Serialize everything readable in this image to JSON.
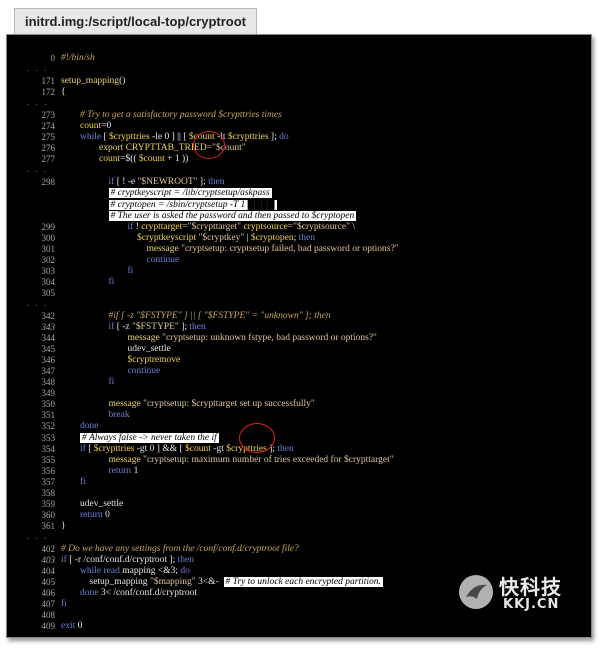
{
  "tab": {
    "title": "initrd.img:/script/local-top/cryptroot"
  },
  "watermark": {
    "cn": "快科技",
    "domain": "KKJ.CN"
  },
  "lines": [
    {
      "n": "0",
      "segs": [
        [
          "cmt",
          "#!/bin/sh"
        ]
      ]
    },
    {
      "sep": true
    },
    {
      "n": "171",
      "segs": [
        [
          "fn",
          "setup_mapping"
        ],
        [
          "plain",
          "()"
        ]
      ]
    },
    {
      "n": "172",
      "segs": [
        [
          "plain",
          "{"
        ]
      ]
    },
    {
      "sep": true
    },
    {
      "n": "273",
      "segs": [
        [
          "plain",
          "        "
        ],
        [
          "cmt",
          "# Try to get a satisfactory password $crypttries times"
        ]
      ]
    },
    {
      "n": "274",
      "segs": [
        [
          "plain",
          "        "
        ],
        [
          "var",
          "count"
        ],
        [
          "plain",
          "=0"
        ]
      ]
    },
    {
      "n": "275",
      "segs": [
        [
          "plain",
          "        "
        ],
        [
          "kw",
          "while"
        ],
        [
          "plain",
          " [ "
        ],
        [
          "var",
          "$crypttries"
        ],
        [
          "plain",
          " -le 0 ] || [ "
        ],
        [
          "var",
          "$count"
        ],
        [
          "plain",
          " -lt "
        ],
        [
          "var",
          "$crypttries"
        ],
        [
          "plain",
          " ]; "
        ],
        [
          "kw",
          "do"
        ]
      ]
    },
    {
      "n": "276",
      "segs": [
        [
          "plain",
          "                "
        ],
        [
          "fn",
          "export"
        ],
        [
          "plain",
          " "
        ],
        [
          "var",
          "CRYPTTAB_TRIED"
        ],
        [
          "str",
          "=\"$count\""
        ]
      ]
    },
    {
      "n": "277",
      "segs": [
        [
          "plain",
          "                "
        ],
        [
          "var",
          "count"
        ],
        [
          "plain",
          "=$(( "
        ],
        [
          "var",
          "$count"
        ],
        [
          "plain",
          " + 1 ))"
        ]
      ]
    },
    {
      "sep": true
    },
    {
      "n": "298",
      "segs": [
        [
          "plain",
          "                    "
        ],
        [
          "kw",
          "if"
        ],
        [
          "plain",
          " [ ! -e "
        ],
        [
          "str",
          "\"$NEWROOT\""
        ],
        [
          "plain",
          " ]; "
        ],
        [
          "kw",
          "then"
        ]
      ]
    },
    {
      "n": "",
      "segs": [
        [
          "plain",
          "                    "
        ],
        [
          "hl",
          "# cryptkeyscript = /lib/cryptsetup/askpass"
        ]
      ]
    },
    {
      "n": "",
      "segs": [
        [
          "plain",
          "                    "
        ],
        [
          "hl",
          "# cryptopen = /sbin/cryptsetup -T 1 ████"
        ]
      ]
    },
    {
      "n": "",
      "segs": [
        [
          "plain",
          "                    "
        ],
        [
          "hl",
          "# The user is asked the password and then passed to $cryptopen"
        ]
      ]
    },
    {
      "n": "299",
      "segs": [
        [
          "plain",
          "                            "
        ],
        [
          "kw",
          "if"
        ],
        [
          "plain",
          " ! "
        ],
        [
          "var",
          "crypttarget"
        ],
        [
          "str",
          "=\"$crypttarget\""
        ],
        [
          "plain",
          " "
        ],
        [
          "var",
          "cryptsource"
        ],
        [
          "str",
          "=\"$cryptsource\""
        ],
        [
          "plain",
          " \\"
        ]
      ]
    },
    {
      "n": "300",
      "segs": [
        [
          "plain",
          "                                "
        ],
        [
          "var",
          "$cryptkeyscript"
        ],
        [
          "plain",
          " "
        ],
        [
          "str",
          "\"$cryptkey\""
        ],
        [
          "plain",
          " | "
        ],
        [
          "var",
          "$cryptopen"
        ],
        [
          "plain",
          "; "
        ],
        [
          "kw",
          "then"
        ]
      ]
    },
    {
      "n": "301",
      "segs": [
        [
          "plain",
          "                                    "
        ],
        [
          "fn",
          "message"
        ],
        [
          "plain",
          " "
        ],
        [
          "str",
          "\"cryptsetup: cryptsetup failed, bad password or options?\""
        ]
      ]
    },
    {
      "n": "302",
      "segs": [
        [
          "plain",
          "                                    "
        ],
        [
          "kw",
          "continue"
        ]
      ]
    },
    {
      "n": "303",
      "segs": [
        [
          "plain",
          "                            "
        ],
        [
          "kw",
          "fi"
        ]
      ]
    },
    {
      "n": "304",
      "segs": [
        [
          "plain",
          "                    "
        ],
        [
          "kw",
          "fi"
        ]
      ]
    },
    {
      "n": "305",
      "segs": []
    },
    {
      "sep": true
    },
    {
      "n": "342",
      "segs": [
        [
          "plain",
          "                    "
        ],
        [
          "cmt",
          "#if [ -z \"$FSTYPE\" ] || [ \"$FSTYPE\" = \"unknown\" ]; then"
        ]
      ]
    },
    {
      "n": "343",
      "it": true,
      "segs": [
        [
          "plain",
          "                    "
        ],
        [
          "kw",
          "if"
        ],
        [
          "plain",
          " [ -z "
        ],
        [
          "str",
          "\"$FSTYPE\""
        ],
        [
          "plain",
          " ]; "
        ],
        [
          "kw",
          "then"
        ]
      ]
    },
    {
      "n": "344",
      "segs": [
        [
          "plain",
          "                            "
        ],
        [
          "fn",
          "message"
        ],
        [
          "plain",
          " "
        ],
        [
          "str",
          "\"cryptsetup: unknown fstype, bad password or options?\""
        ]
      ]
    },
    {
      "n": "345",
      "segs": [
        [
          "plain",
          "                            "
        ],
        [
          "plain",
          "udev_settle"
        ]
      ]
    },
    {
      "n": "346",
      "segs": [
        [
          "plain",
          "                            "
        ],
        [
          "var",
          "$cryptremove"
        ]
      ]
    },
    {
      "n": "347",
      "segs": [
        [
          "plain",
          "                            "
        ],
        [
          "kw",
          "continue"
        ]
      ]
    },
    {
      "n": "348",
      "segs": [
        [
          "plain",
          "                    "
        ],
        [
          "kw",
          "fi"
        ]
      ]
    },
    {
      "n": "349",
      "segs": []
    },
    {
      "n": "350",
      "segs": [
        [
          "plain",
          "                    "
        ],
        [
          "fn",
          "message"
        ],
        [
          "plain",
          " "
        ],
        [
          "str",
          "\"cryptsetup: $crypttarget set up successfully\""
        ]
      ]
    },
    {
      "n": "351",
      "segs": [
        [
          "plain",
          "                    "
        ],
        [
          "kw",
          "break"
        ]
      ]
    },
    {
      "n": "352",
      "segs": [
        [
          "plain",
          "        "
        ],
        [
          "kw",
          "done"
        ]
      ]
    },
    {
      "n": "353",
      "segs": [
        [
          "plain",
          "        "
        ],
        [
          "hl",
          "# Always false -> never taken the if"
        ]
      ]
    },
    {
      "n": "354",
      "segs": [
        [
          "plain",
          "        "
        ],
        [
          "kw",
          "if"
        ],
        [
          "plain",
          " [ "
        ],
        [
          "var",
          "$crypttries"
        ],
        [
          "plain",
          " -gt 0 ] && [ "
        ],
        [
          "var",
          "$count"
        ],
        [
          "plain",
          " -gt "
        ],
        [
          "var",
          "$crypttries"
        ],
        [
          "plain",
          " ]; "
        ],
        [
          "kw",
          "then"
        ]
      ]
    },
    {
      "n": "355",
      "segs": [
        [
          "plain",
          "                    "
        ],
        [
          "fn",
          "message"
        ],
        [
          "plain",
          " "
        ],
        [
          "str",
          "\"cryptsetup: maximum number of tries exceeded for $crypttarget\""
        ]
      ]
    },
    {
      "n": "356",
      "segs": [
        [
          "plain",
          "                    "
        ],
        [
          "kw",
          "return"
        ],
        [
          "plain",
          " 1"
        ]
      ]
    },
    {
      "n": "357",
      "segs": [
        [
          "plain",
          "        "
        ],
        [
          "kw",
          "fi"
        ]
      ]
    },
    {
      "n": "358",
      "segs": []
    },
    {
      "n": "359",
      "segs": [
        [
          "plain",
          "        "
        ],
        [
          "plain",
          "udev_settle"
        ]
      ]
    },
    {
      "n": "360",
      "segs": [
        [
          "plain",
          "        "
        ],
        [
          "kw",
          "return"
        ],
        [
          "plain",
          " 0"
        ]
      ]
    },
    {
      "n": "361",
      "segs": [
        [
          "plain",
          "}"
        ]
      ]
    },
    {
      "sep": true
    },
    {
      "n": "402",
      "segs": [
        [
          "cmt",
          "# Do we have any settings from the /conf/conf.d/cryptroot file?"
        ]
      ]
    },
    {
      "n": "403",
      "it": true,
      "segs": [
        [
          "kw",
          "if"
        ],
        [
          "plain",
          " [ -r /conf/conf.d/cryptroot ]; "
        ],
        [
          "kw",
          "then"
        ]
      ]
    },
    {
      "n": "404",
      "segs": [
        [
          "plain",
          "        "
        ],
        [
          "kw",
          "while"
        ],
        [
          "plain",
          " "
        ],
        [
          "kw",
          "read"
        ],
        [
          "plain",
          " mapping <&3; "
        ],
        [
          "kw",
          "do"
        ]
      ]
    },
    {
      "n": "405",
      "segs": [
        [
          "plain",
          "            "
        ],
        [
          "plain",
          "setup_mapping "
        ],
        [
          "str",
          "\"$mapping\""
        ],
        [
          "plain",
          " 3<&-  "
        ],
        [
          "hl",
          "# Try to unlock each encrypted partition."
        ]
      ]
    },
    {
      "n": "406",
      "segs": [
        [
          "plain",
          "        "
        ],
        [
          "kw",
          "done"
        ],
        [
          "plain",
          " 3< /conf/conf.d/cryptroot"
        ]
      ]
    },
    {
      "n": "407",
      "segs": [
        [
          "kw",
          "fi"
        ]
      ]
    },
    {
      "n": "408",
      "segs": []
    },
    {
      "n": "409",
      "segs": [
        [
          "kw",
          "exit"
        ],
        [
          "plain",
          " 0"
        ]
      ]
    }
  ],
  "separator_text": ". . ."
}
